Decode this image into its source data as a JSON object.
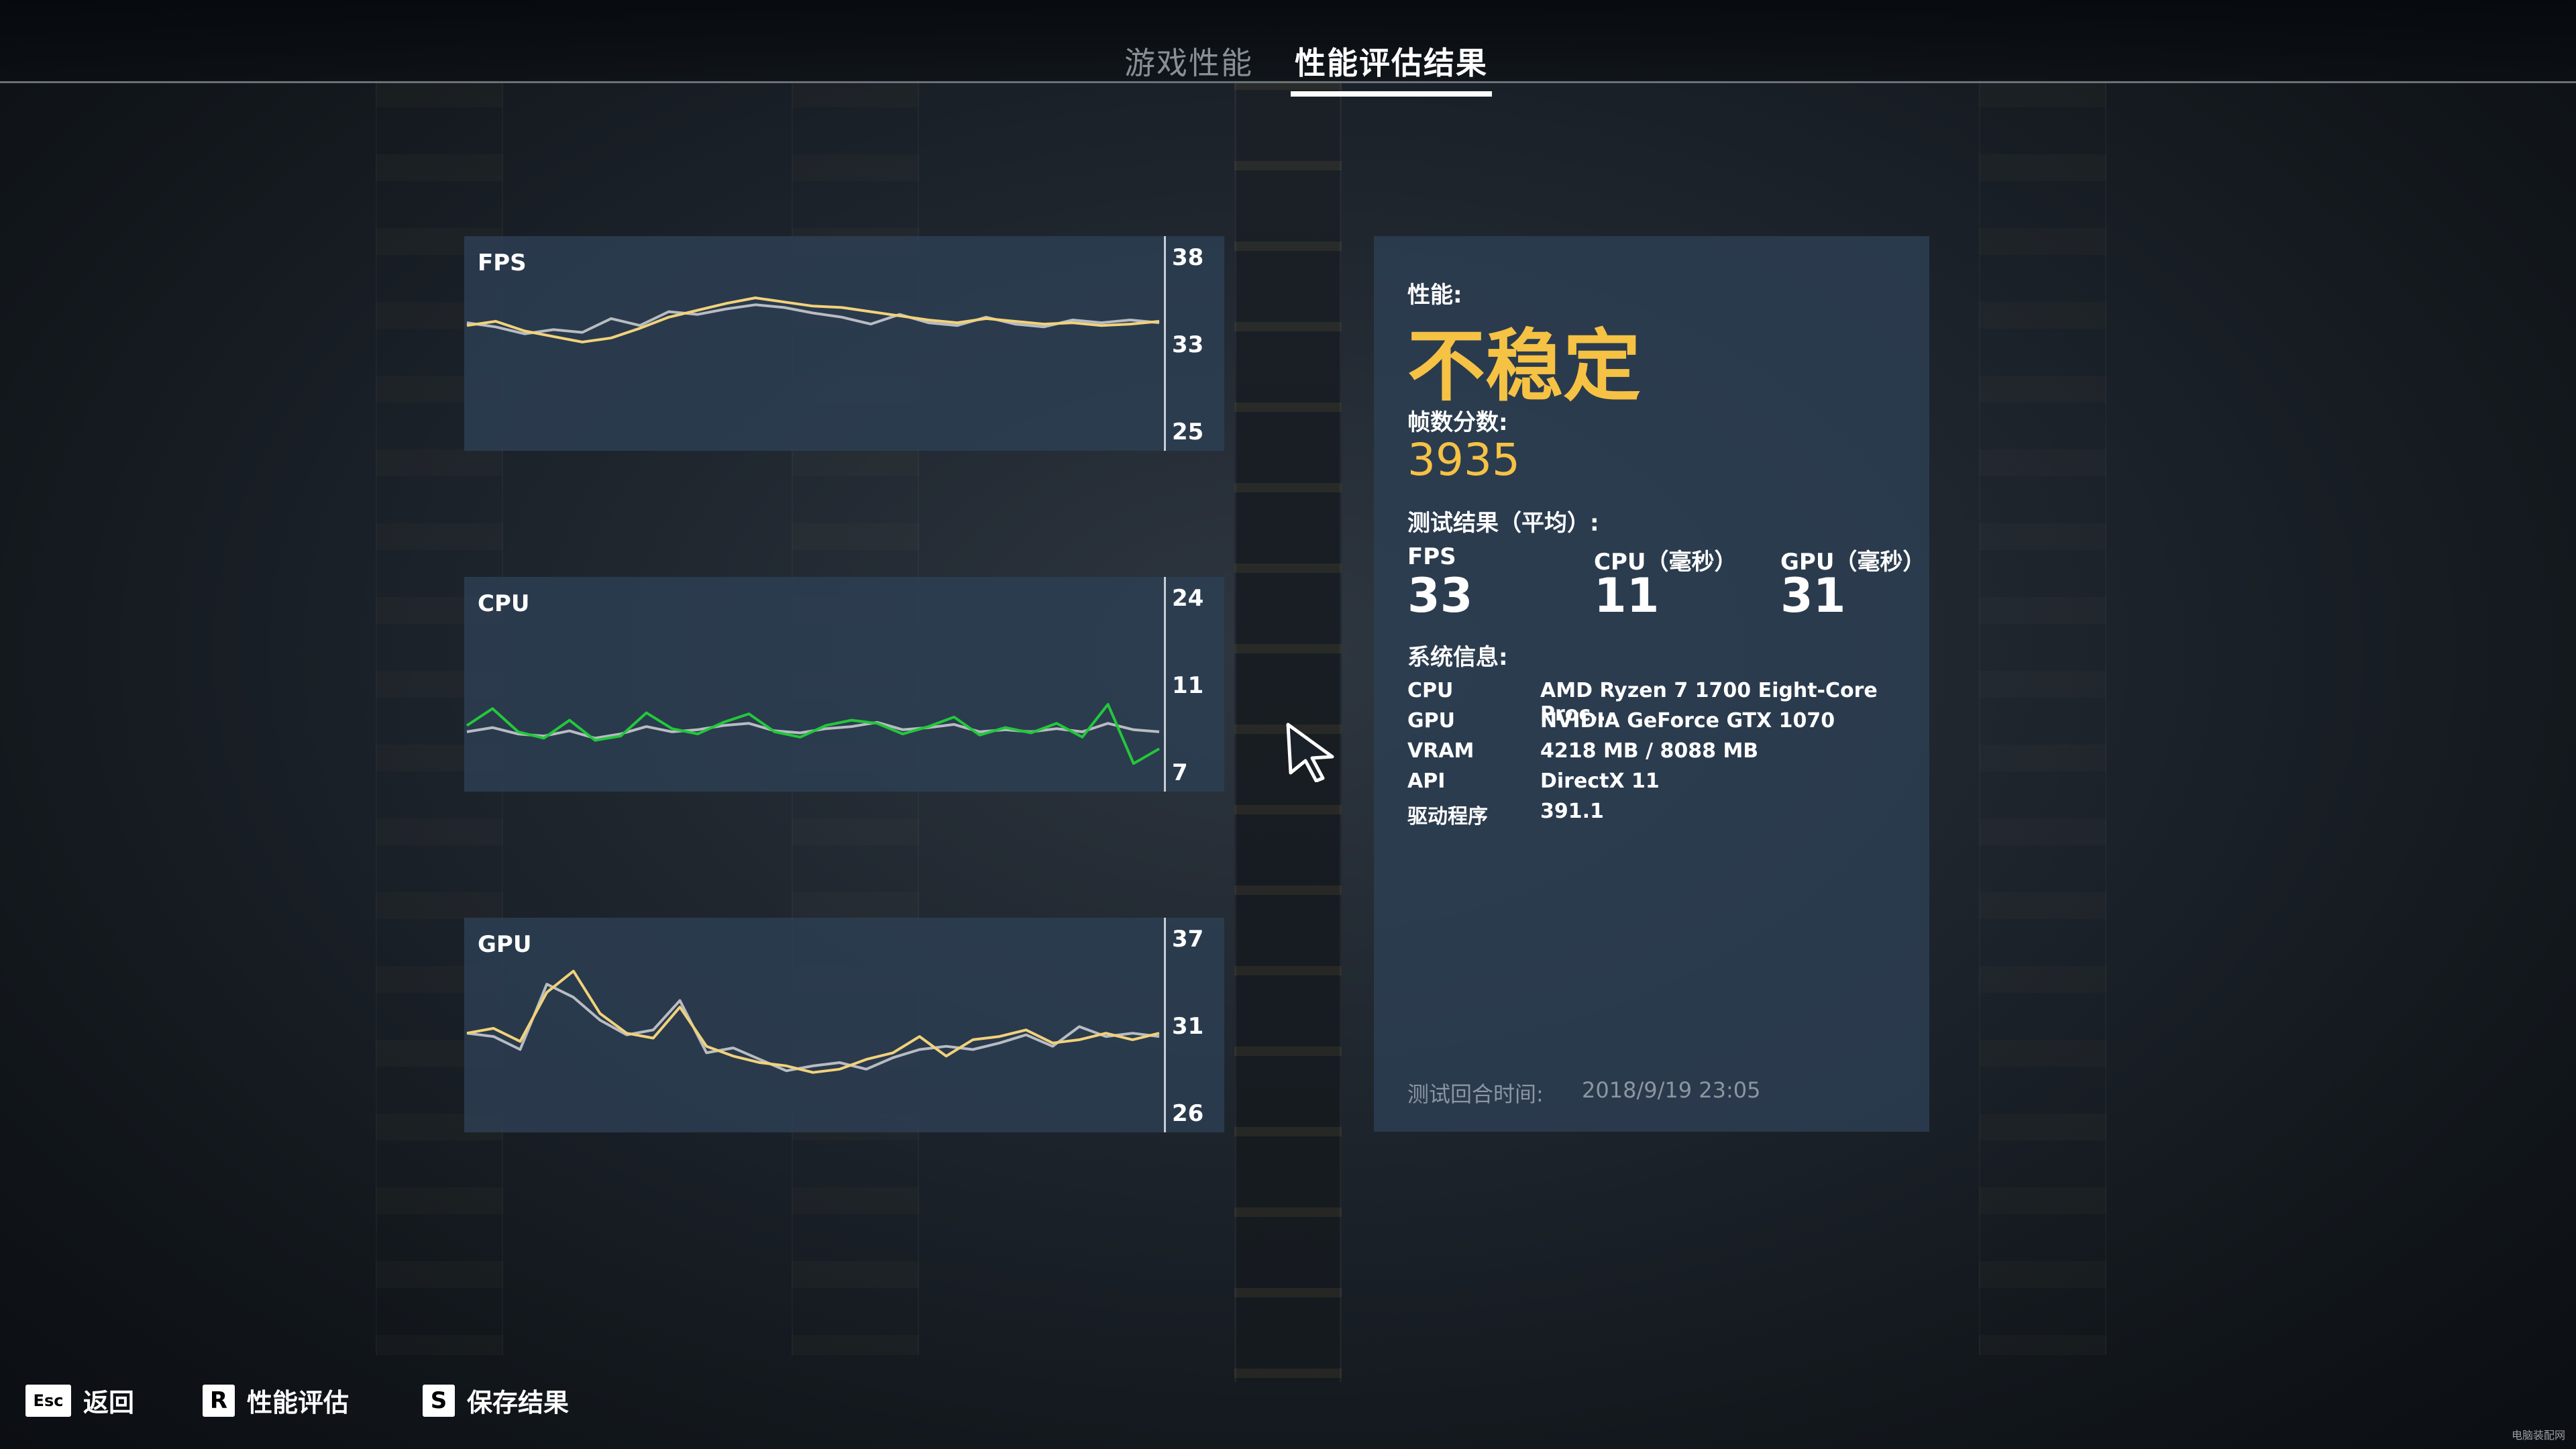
{
  "tabs": [
    {
      "label": "游戏性能",
      "active": false
    },
    {
      "label": "性能评估结果",
      "active": true
    }
  ],
  "charts": [
    {
      "title": "FPS",
      "ticks": {
        "top": "38",
        "mid": "33",
        "bottom": "25"
      }
    },
    {
      "title": "CPU",
      "ticks": {
        "top": "24",
        "mid": "11",
        "bottom": "7"
      }
    },
    {
      "title": "GPU",
      "ticks": {
        "top": "37",
        "mid": "31",
        "bottom": "26"
      }
    }
  ],
  "results": {
    "performance_label": "性能:",
    "performance_value": "不稳定",
    "score_label": "帧数分数:",
    "score_value": "3935",
    "averages_label": "测试结果（平均）:",
    "metrics": [
      {
        "label": "FPS",
        "value": "33"
      },
      {
        "label": "CPU（毫秒）",
        "value": "11"
      },
      {
        "label": "GPU（毫秒）",
        "value": "31"
      }
    ],
    "system_label": "系统信息:",
    "system": [
      {
        "key": "CPU",
        "value": "AMD Ryzen 7 1700 Eight-Core Proc..."
      },
      {
        "key": "GPU",
        "value": "NVIDIA GeForce GTX 1070"
      },
      {
        "key": "VRAM",
        "value": "4218 MB / 8088 MB"
      },
      {
        "key": "API",
        "value": "DirectX 11"
      },
      {
        "key": "驱动程序",
        "value": "391.1"
      }
    ],
    "timestamp_label": "测试回合时间:",
    "timestamp_value": "2018/9/19 23:05"
  },
  "hints": [
    {
      "key": "Esc",
      "label": "返回"
    },
    {
      "key": "R",
      "label": "性能评估"
    },
    {
      "key": "S",
      "label": "保存结果"
    }
  ],
  "watermark": "电脑装配网",
  "colors": {
    "accent": "#f6c244",
    "panel": "#2d4054",
    "series_gray": "#b8bcc2",
    "series_yellow": "#f2d27a",
    "series_red": "#e8553a",
    "series_green": "#22c83a"
  },
  "chart_data": [
    {
      "type": "line",
      "title": "FPS",
      "ylim": [
        25,
        38
      ],
      "yticks": [
        38,
        33,
        25
      ],
      "series": [
        {
          "color": "yellow",
          "values": [
            32.8,
            33.1,
            32.4,
            32.0,
            31.6,
            31.9,
            32.6,
            33.4,
            33.9,
            34.4,
            34.8,
            34.5,
            34.2,
            34.1,
            33.8,
            33.5,
            33.2,
            33.0,
            33.3,
            33.1,
            32.9,
            33.0,
            32.8,
            32.9,
            33.1
          ]
        },
        {
          "color": "gray",
          "values": [
            33.0,
            32.7,
            32.2,
            32.5,
            32.3,
            33.3,
            32.8,
            33.8,
            33.6,
            34.0,
            34.3,
            34.1,
            33.7,
            33.4,
            32.9,
            33.6,
            33.0,
            32.8,
            33.4,
            32.9,
            32.7,
            33.2,
            33.0,
            33.2,
            33.0
          ]
        }
      ]
    },
    {
      "type": "line",
      "title": "CPU",
      "ylim": [
        7,
        24
      ],
      "yticks": [
        24,
        11,
        7
      ],
      "series": [
        {
          "color": "green",
          "values": [
            11.6,
            13.2,
            11.0,
            10.4,
            12.1,
            10.2,
            10.6,
            12.8,
            11.3,
            10.8,
            11.9,
            12.7,
            11.0,
            10.5,
            11.6,
            12.1,
            11.8,
            10.8,
            11.5,
            12.4,
            10.7,
            11.4,
            10.9,
            11.8,
            10.5,
            13.6,
            8.0,
            9.4
          ]
        },
        {
          "color": "gray",
          "values": [
            11.0,
            11.4,
            10.8,
            10.6,
            11.1,
            10.4,
            10.8,
            11.5,
            11.0,
            11.2,
            11.6,
            11.8,
            11.1,
            10.9,
            11.3,
            11.5,
            11.9,
            11.2,
            11.4,
            11.7,
            11.0,
            11.2,
            11.0,
            11.3,
            11.0,
            11.8,
            11.2,
            11.0
          ]
        }
      ]
    },
    {
      "type": "line",
      "title": "GPU",
      "ylim": [
        26,
        37
      ],
      "yticks": [
        37,
        31,
        26
      ],
      "series": [
        {
          "color": "yellow",
          "values": [
            31.0,
            31.3,
            30.5,
            33.5,
            34.8,
            32.2,
            31.0,
            30.7,
            32.6,
            30.2,
            29.6,
            29.2,
            29.0,
            28.6,
            28.8,
            29.4,
            29.8,
            30.8,
            29.6,
            30.6,
            30.8,
            31.2,
            30.4,
            30.6,
            31.0,
            30.6,
            31.0
          ]
        },
        {
          "color": "gray",
          "values": [
            31.0,
            30.8,
            30.0,
            34.0,
            33.2,
            31.8,
            30.9,
            31.2,
            33.0,
            29.8,
            30.1,
            29.4,
            28.7,
            29.0,
            29.2,
            28.8,
            29.5,
            30.0,
            30.2,
            30.0,
            30.4,
            30.9,
            30.2,
            31.4,
            30.8,
            31.0,
            30.8
          ]
        }
      ]
    }
  ]
}
